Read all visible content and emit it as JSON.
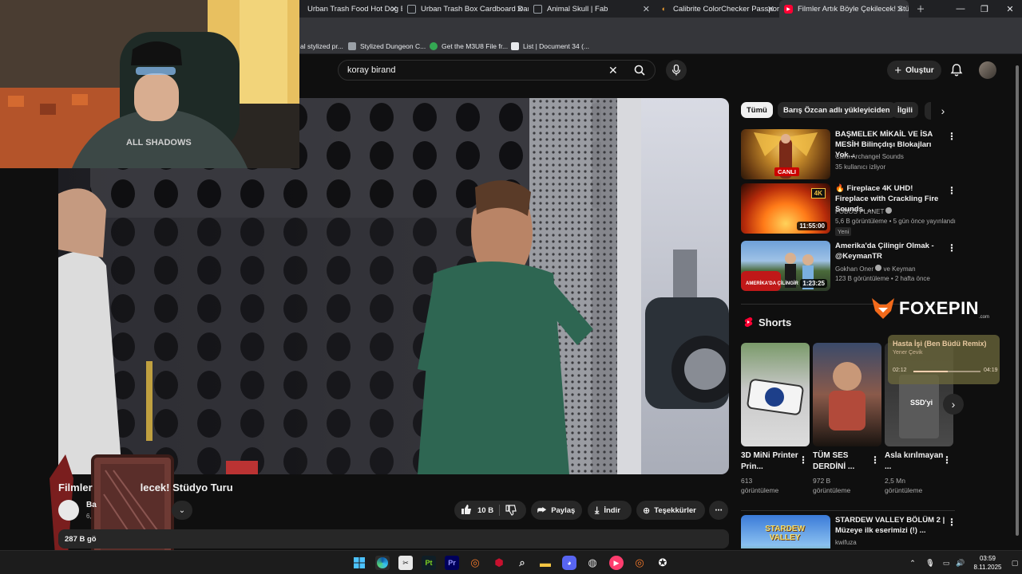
{
  "browser": {
    "tabs": [
      {
        "title": "Urban Trash Food Hot Dog Eaten",
        "icon_color": "#cc5a3c"
      },
      {
        "title": "Urban Trash Box Cardboard Dam",
        "icon_color": "#9aa0a6"
      },
      {
        "title": "Animal Skull | Fab",
        "icon_color": "#9aa0a6"
      },
      {
        "title": "Calibrite ColorChecker Passport P",
        "icon_color": "#f0a030"
      },
      {
        "title": "Filmler Artık Böyle Çekilecek! Stü",
        "icon_color": "#ff0033"
      }
    ],
    "bookmarks": [
      {
        "label": "al stylized pr...",
        "color": "#7a7a7a"
      },
      {
        "label": "Stylized Dungeon C...",
        "color": "#9aa0a6"
      },
      {
        "label": "Get the M3U8 File fr...",
        "color": "#34a853"
      },
      {
        "label": "List | Document 34 (...",
        "color": "#e8eaed"
      }
    ]
  },
  "header": {
    "search_value": "koray birand",
    "create_label": "Oluştur"
  },
  "overlay": {
    "foxepin_logo": "FOXEPIN",
    "foxepin_sub": ".com",
    "music_title": "Hasta İşi (Ben Büdü Remix)",
    "music_artist": "Yener Çevik",
    "music_elapsed": "02:12",
    "music_total": "04:19",
    "music_progress": 0.51,
    "webcam_shirt_text": "ALL SHADOWS"
  },
  "video": {
    "title_visible": "Filmler",
    "title_rest": "lecek! Stüdyo Turu",
    "channel_name": "Ba",
    "channel_subs": "6,",
    "likes": "10 B",
    "share_label": "Paylaş",
    "download_label": "İndir",
    "thanks_label": "Teşekkürler",
    "views_partial": "287 B gö"
  },
  "sidebar": {
    "chips": [
      "Tümü",
      "Barış Özcan adlı yükleyiciden",
      "İlgili"
    ],
    "recs": [
      {
        "title": "BAŞMELEK MİKAİL VE İSA MESİH Bilinçdışı Blokajları Yok...",
        "channel": "Calm Archangel Sounds",
        "meta": "35 kullanıcı izliyor",
        "badge": "CANLI",
        "thumb": "archangel-thumb"
      },
      {
        "title": "🔥 Fireplace 4K UHD! Fireplace with Crackling Fire Sounds. ...",
        "channel": "FOBOS PLANET",
        "meta": "5,6 B görüntüleme • 5 gün önce yayınlandı",
        "new": "Yeni",
        "duration": "11:55:00",
        "thumb": "fire-thumb"
      },
      {
        "title": "Amerika'da Çilingir Olmak - @KeymanTR",
        "channel": "Gokhan Oner",
        "channel_suffix": "ve Keyman",
        "meta": "123 B görüntüleme • 2 hafta önce",
        "duration": "1:23:25",
        "thumb": "locksmith-thumb"
      }
    ],
    "shorts_title": "Shorts",
    "shorts": [
      {
        "title": "3D MiNi Printer Prin...",
        "views": "613",
        "unit": "görüntüleme"
      },
      {
        "title": "TÜM SES DERDİNİ ...",
        "views": "972 B",
        "unit": "görüntüleme"
      },
      {
        "title": "Asla kırılmayan ...",
        "views": "2,5 Mn",
        "unit": "görüntüleme"
      }
    ],
    "bottom_rec": {
      "title": "STARDEW VALLEY BÖLÜM 2 | Müzeye ilk eserimizi (!) ...",
      "channel": "kwifuza",
      "thumb_text": "STARDEW VALLEY"
    }
  },
  "taskbar": {
    "time": "03:59",
    "date": "8.11.2025"
  }
}
